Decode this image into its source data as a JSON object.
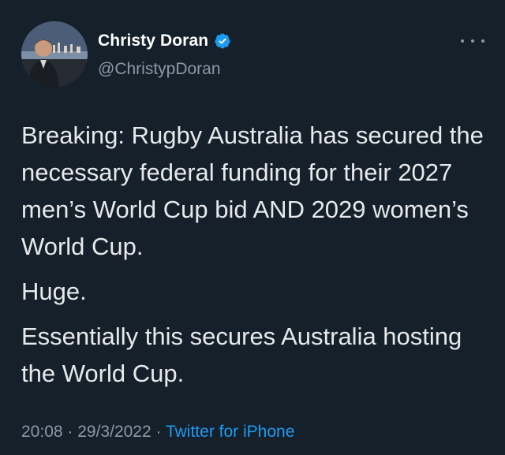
{
  "author": {
    "name": "Christy Doran",
    "handle": "@ChristypDoran",
    "verified": true,
    "verified_color": "#1d9bf0"
  },
  "icons": {
    "verified": "verified-badge-icon",
    "more": "more-horizontal-icon"
  },
  "tweet": {
    "paragraphs": [
      "Breaking: Rugby Australia has secured the necessary federal funding for their 2027 men’s World Cup bid AND 2029 women’s World Cup.",
      "Huge.",
      "Essentially this secures Australia hosting the World Cup."
    ]
  },
  "meta": {
    "time": "20:08",
    "sep1": " · ",
    "date": "29/3/2022",
    "sep2": " · ",
    "source": "Twitter for iPhone"
  },
  "colors": {
    "background": "#15202b",
    "text": "#e7e9ea",
    "secondary": "#8b98a5",
    "accent": "#1d9bf0"
  }
}
